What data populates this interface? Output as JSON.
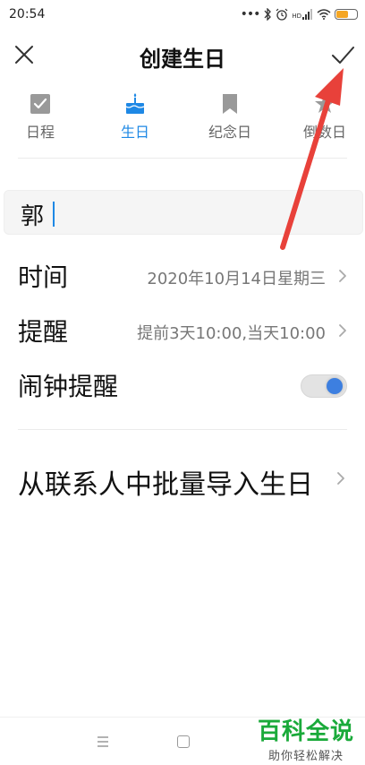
{
  "status_bar": {
    "time": "20:54",
    "signal_text": "HD",
    "battery_level": 0.55,
    "battery_color": "#f5a623"
  },
  "header": {
    "title": "创建生日",
    "close_icon": "close-icon",
    "confirm_icon": "check-icon"
  },
  "tabs": [
    {
      "label": "日程",
      "icon": "calendar-check-icon",
      "active": false
    },
    {
      "label": "生日",
      "icon": "cake-icon",
      "active": true
    },
    {
      "label": "纪念日",
      "icon": "bookmark-icon",
      "active": false
    },
    {
      "label": "倒数日",
      "icon": "star-icon",
      "active": false
    }
  ],
  "name_field": {
    "value": "郭"
  },
  "rows": {
    "time": {
      "label": "时间",
      "value": "2020年10月14日星期三"
    },
    "reminder": {
      "label": "提醒",
      "value": "提前3天10:00,当天10:00"
    },
    "alarm": {
      "label": "闹钟提醒",
      "enabled": true
    },
    "import": {
      "label": "从联系人中批量导入生日"
    }
  },
  "watermark": {
    "title": "百科全说",
    "subtitle": "助你轻松解决"
  },
  "colors": {
    "accent": "#1e88e5",
    "toggle_knob": "#3d7fe0",
    "annotation_arrow": "#e8413a",
    "watermark_green": "#1aaa3a"
  }
}
